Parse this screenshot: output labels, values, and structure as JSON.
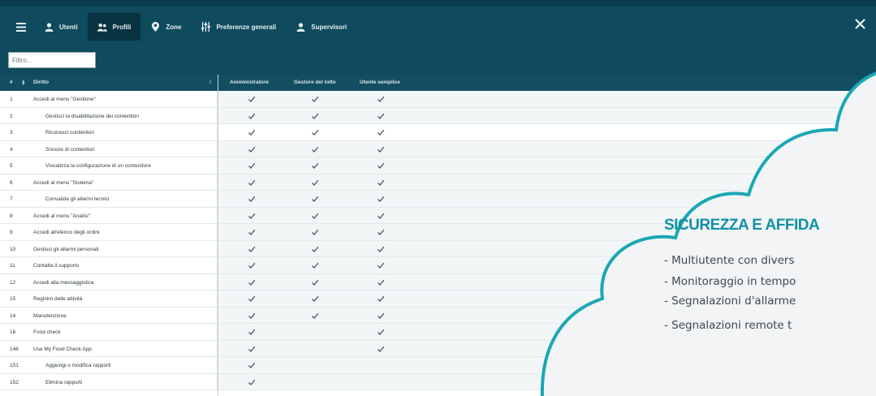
{
  "nav": {
    "menu_icon": "hamburger-icon",
    "items": [
      {
        "label": "Utenti",
        "icon": "user-icon",
        "active": false
      },
      {
        "label": "Profili",
        "icon": "users-icon",
        "active": true
      },
      {
        "label": "Zone",
        "icon": "location-pin-icon",
        "active": false
      },
      {
        "label": "Preferenze generali",
        "icon": "sliders-icon",
        "active": false
      },
      {
        "label": "Supervisori",
        "icon": "user-icon",
        "active": false
      }
    ],
    "close_icon": "close-icon"
  },
  "filter": {
    "placeholder": "Filtro..."
  },
  "table": {
    "columns": {
      "id": "#",
      "sort": "⇕",
      "right": "Diritto",
      "admin": "Amministratore",
      "manager": "Gestore del lotto",
      "simple": "Utente semplice"
    },
    "rows": [
      {
        "id": "1",
        "label": "Accedi al menu \"Gestione\"",
        "indent": 0,
        "admin": true,
        "manager": true,
        "simple": true
      },
      {
        "id": "2",
        "label": "Gestisci la disabilitazione dei contenitori",
        "indent": 1,
        "admin": true,
        "manager": true,
        "simple": true
      },
      {
        "id": "3",
        "label": "Riconosci contenitori",
        "indent": 1,
        "admin": true,
        "manager": true,
        "simple": true,
        "highlight": true
      },
      {
        "id": "4",
        "label": "Snooze di contenitori",
        "indent": 1,
        "admin": true,
        "manager": true,
        "simple": true
      },
      {
        "id": "5",
        "label": "Visualizza la configurazione di un contenitore",
        "indent": 1,
        "admin": true,
        "manager": true,
        "simple": true
      },
      {
        "id": "6",
        "label": "Accedi al menu \"Sistema\"",
        "indent": 0,
        "admin": true,
        "manager": true,
        "simple": true
      },
      {
        "id": "7",
        "label": "Convalida gli allarmi tecnici",
        "indent": 1,
        "admin": true,
        "manager": true,
        "simple": true
      },
      {
        "id": "8",
        "label": "Accedi al menu \"Analisi\"",
        "indent": 0,
        "admin": true,
        "manager": true,
        "simple": true
      },
      {
        "id": "9",
        "label": "Accedi all'elenco degli ordini",
        "indent": 0,
        "admin": true,
        "manager": true,
        "simple": true
      },
      {
        "id": "10",
        "label": "Gestisci gli allarmi personali",
        "indent": 0,
        "admin": true,
        "manager": true,
        "simple": true
      },
      {
        "id": "11",
        "label": "Contatta il supporto",
        "indent": 0,
        "admin": true,
        "manager": true,
        "simple": true
      },
      {
        "id": "12",
        "label": "Accedi alla messaggistica",
        "indent": 0,
        "admin": true,
        "manager": true,
        "simple": true
      },
      {
        "id": "15",
        "label": "Registro delle attività",
        "indent": 0,
        "admin": true,
        "manager": true,
        "simple": true
      },
      {
        "id": "14",
        "label": "Manutenzione",
        "indent": 0,
        "admin": true,
        "manager": true,
        "simple": true
      },
      {
        "id": "16",
        "label": "Food check",
        "indent": 0,
        "admin": true,
        "manager": false,
        "simple": true
      },
      {
        "id": "146",
        "label": "Use My Food Check App",
        "indent": 0,
        "admin": true,
        "manager": false,
        "simple": true
      },
      {
        "id": "151",
        "label": "Aggiungi o modifica rapporti",
        "indent": 1,
        "admin": true,
        "manager": false,
        "simple": false
      },
      {
        "id": "152",
        "label": "Elimina rapporti",
        "indent": 1,
        "admin": true,
        "manager": false,
        "simple": false
      }
    ]
  },
  "promo": {
    "title": "SICUREZZA E AFFIDA",
    "lines": [
      "- Multiutente con divers",
      "- Monitoraggio in tempo",
      "- Segnalazioni d'allarme",
      "- Segnalazioni remote t"
    ]
  },
  "colors": {
    "header": "#0f4a5e",
    "active_tab": "#0a3342",
    "cloud_fill": "#f2f4f5",
    "cloud_stroke": "#1aa7b3",
    "title": "#1190a6"
  }
}
